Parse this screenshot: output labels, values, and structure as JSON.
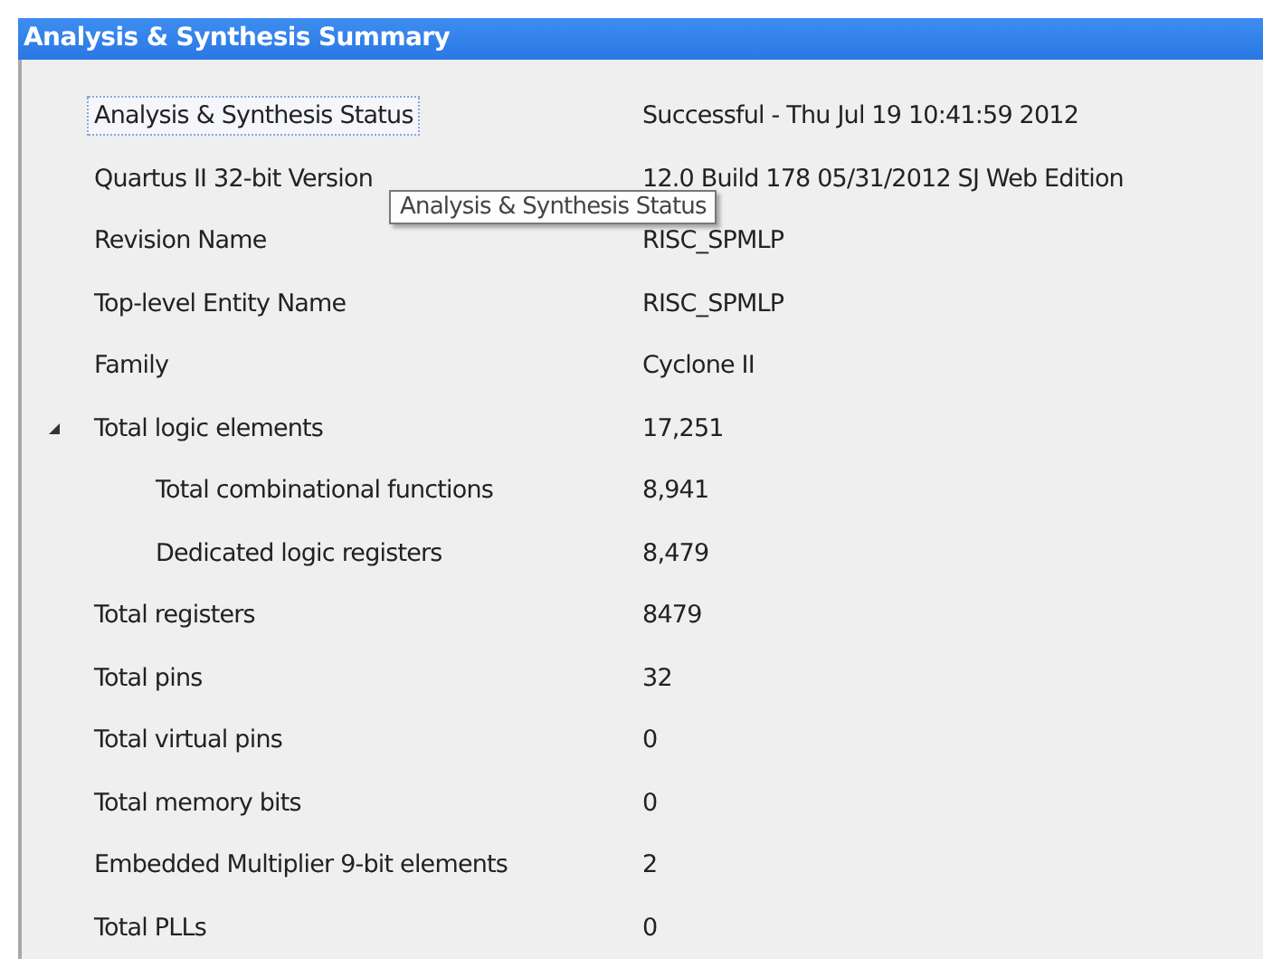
{
  "panel": {
    "title": "Analysis & Synthesis Summary"
  },
  "rows": [
    {
      "label": "Analysis & Synthesis Status",
      "value": "Successful - Thu Jul 19 10:41:59 2012",
      "selected": true
    },
    {
      "label": "Quartus II 32-bit Version",
      "value": "12.0 Build 178 05/31/2012 SJ Web Edition",
      "selected": false
    },
    {
      "label": "Revision Name",
      "value": "RISC_SPMLP",
      "selected": false
    },
    {
      "label": "Top-level Entity Name",
      "value": "RISC_SPMLP",
      "selected": false
    },
    {
      "label": "Family",
      "value": "Cyclone II",
      "selected": false
    },
    {
      "label": "Total logic elements",
      "value": "17,251",
      "selected": false,
      "expanded": true,
      "children": [
        {
          "label": "Total combinational functions",
          "value": "8,941",
          "selected": false
        },
        {
          "label": "Dedicated logic registers",
          "value": "8,479",
          "selected": false
        }
      ]
    },
    {
      "label": "Total registers",
      "value": "8479",
      "selected": false
    },
    {
      "label": "Total pins",
      "value": "32",
      "selected": false
    },
    {
      "label": "Total virtual pins",
      "value": "0",
      "selected": false
    },
    {
      "label": "Total memory bits",
      "value": "0",
      "selected": false
    },
    {
      "label": "Embedded Multiplier 9-bit elements",
      "value": "2",
      "selected": false
    },
    {
      "label": "Total PLLs",
      "value": "0",
      "selected": false
    }
  ],
  "tooltip": {
    "text": "Analysis & Synthesis Status"
  }
}
